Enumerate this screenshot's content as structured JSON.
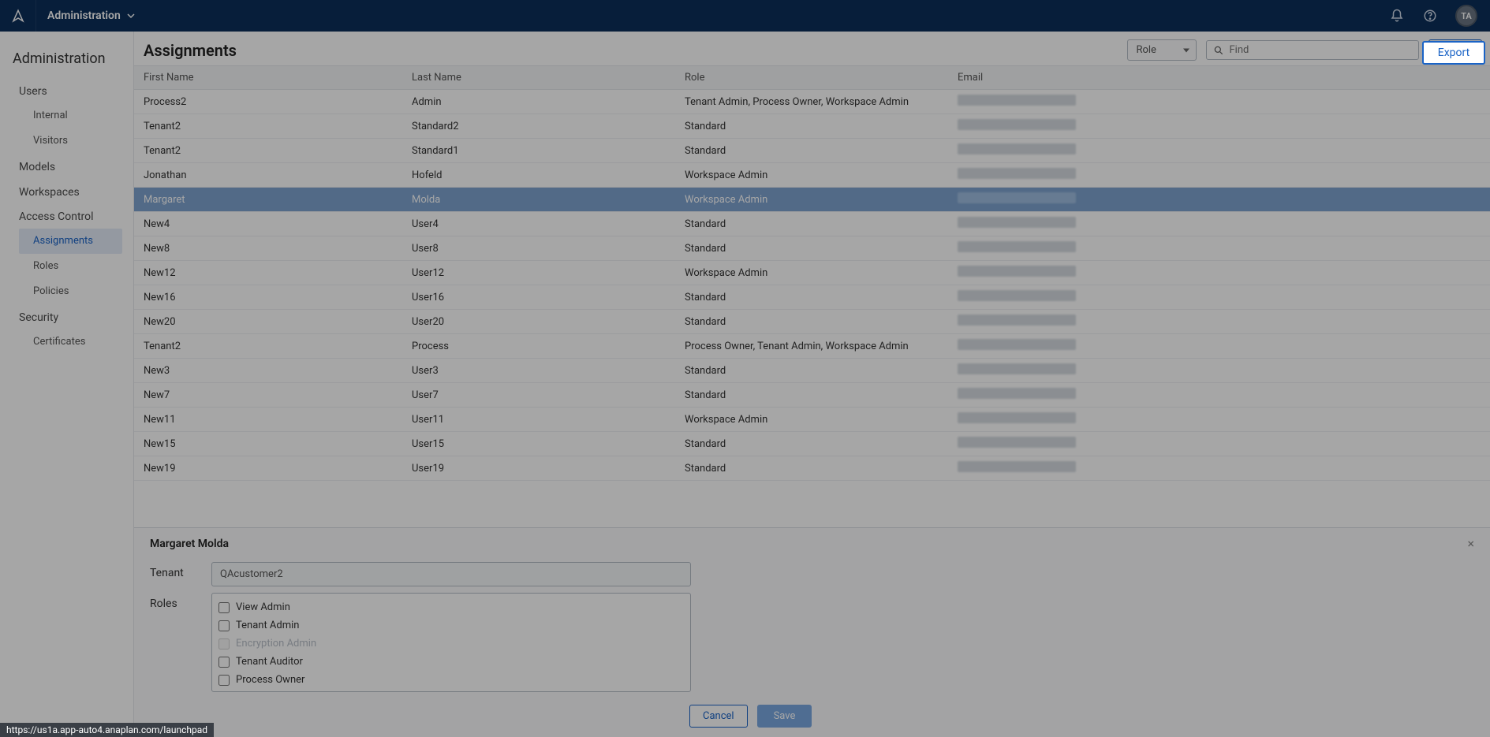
{
  "header": {
    "app_name": "Administration",
    "avatar_initials": "TA"
  },
  "sidebar": {
    "title": "Administration",
    "groups": [
      {
        "label": "Users",
        "items": [
          {
            "label": "Internal"
          },
          {
            "label": "Visitors"
          }
        ]
      },
      {
        "label": "Models",
        "items": []
      },
      {
        "label": "Workspaces",
        "items": []
      },
      {
        "label": "Access Control",
        "items": [
          {
            "label": "Assignments",
            "active": true
          },
          {
            "label": "Roles"
          },
          {
            "label": "Policies"
          }
        ]
      },
      {
        "label": "Security",
        "items": [
          {
            "label": "Certificates"
          }
        ]
      }
    ]
  },
  "page": {
    "title": "Assignments",
    "role_filter_label": "Role",
    "search_placeholder": "Find",
    "export_label": "Export"
  },
  "columns": [
    "First Name",
    "Last Name",
    "Role",
    "Email"
  ],
  "rows": [
    {
      "first": "Process2",
      "last": "Admin",
      "role": "Tenant Admin, Process Owner, Workspace Admin",
      "selected": false
    },
    {
      "first": "Tenant2",
      "last": "Standard2",
      "role": "Standard",
      "selected": false
    },
    {
      "first": "Tenant2",
      "last": "Standard1",
      "role": "Standard",
      "selected": false
    },
    {
      "first": "Jonathan",
      "last": "Hofeld",
      "role": "Workspace Admin",
      "selected": false
    },
    {
      "first": "Margaret",
      "last": "Molda",
      "role": "Workspace Admin",
      "selected": true
    },
    {
      "first": "New4",
      "last": "User4",
      "role": "Standard",
      "selected": false
    },
    {
      "first": "New8",
      "last": "User8",
      "role": "Standard",
      "selected": false
    },
    {
      "first": "New12",
      "last": "User12",
      "role": "Workspace Admin",
      "selected": false
    },
    {
      "first": "New16",
      "last": "User16",
      "role": "Standard",
      "selected": false
    },
    {
      "first": "New20",
      "last": "User20",
      "role": "Standard",
      "selected": false
    },
    {
      "first": "Tenant2",
      "last": "Process",
      "role": "Process Owner, Tenant Admin, Workspace Admin",
      "selected": false
    },
    {
      "first": "New3",
      "last": "User3",
      "role": "Standard",
      "selected": false
    },
    {
      "first": "New7",
      "last": "User7",
      "role": "Standard",
      "selected": false
    },
    {
      "first": "New11",
      "last": "User11",
      "role": "Workspace Admin",
      "selected": false
    },
    {
      "first": "New15",
      "last": "User15",
      "role": "Standard",
      "selected": false
    },
    {
      "first": "New19",
      "last": "User19",
      "role": "Standard",
      "selected": false
    }
  ],
  "detail": {
    "name": "Margaret Molda",
    "tenant_label": "Tenant",
    "tenant_value": "QAcustomer2",
    "roles_label": "Roles",
    "role_options": [
      {
        "label": "View Admin",
        "disabled": false
      },
      {
        "label": "Tenant Admin",
        "disabled": false
      },
      {
        "label": "Encryption Admin",
        "disabled": true
      },
      {
        "label": "Tenant Auditor",
        "disabled": false
      },
      {
        "label": "Process Owner",
        "disabled": false
      }
    ],
    "cancel_label": "Cancel",
    "save_label": "Save"
  },
  "status_url": "https://us1a.app-auto4.anaplan.com/launchpad"
}
